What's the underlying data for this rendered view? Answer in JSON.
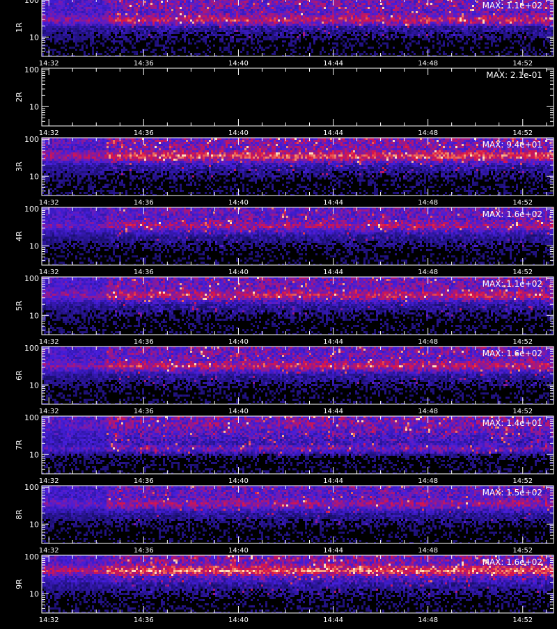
{
  "chart_data": [
    {
      "type": "heatmap",
      "ylabel": "1R",
      "max_label": "MAX: 1.1e+02",
      "max_value": 110,
      "intensity": 0.9,
      "band_rel": 0.35
    },
    {
      "type": "heatmap",
      "ylabel": "2R",
      "max_label": "MAX: 2.1e-01",
      "max_value": 0.21,
      "intensity": 0.0,
      "band_rel": 0.35
    },
    {
      "type": "heatmap",
      "ylabel": "3R",
      "max_label": "MAX: 9.4e+01",
      "max_value": 94,
      "intensity": 1.0,
      "band_rel": 0.3
    },
    {
      "type": "heatmap",
      "ylabel": "4R",
      "max_label": "MAX: 1.6e+02",
      "max_value": 160,
      "intensity": 0.75,
      "band_rel": 0.3
    },
    {
      "type": "heatmap",
      "ylabel": "5R",
      "max_label": "MAX: 1.1e+02",
      "max_value": 110,
      "intensity": 0.85,
      "band_rel": 0.3
    },
    {
      "type": "heatmap",
      "ylabel": "6R",
      "max_label": "MAX: 1.6e+02",
      "max_value": 160,
      "intensity": 0.85,
      "band_rel": 0.32
    },
    {
      "type": "heatmap",
      "ylabel": "7R",
      "max_label": "MAX: 1.4e+01",
      "max_value": 14,
      "intensity": 0.95,
      "band_rel": 0.55
    },
    {
      "type": "heatmap",
      "ylabel": "8R",
      "max_label": "MAX: 1.5e+02",
      "max_value": 150,
      "intensity": 0.7,
      "band_rel": 0.3
    },
    {
      "type": "heatmap",
      "ylabel": "9R",
      "max_label": "MAX: 1.6e+02",
      "max_value": 160,
      "intensity": 1.0,
      "band_rel": 0.25
    }
  ],
  "shared_axes": {
    "x_ticks": [
      "14:32",
      "14:36",
      "14:40",
      "14:44",
      "14:48",
      "14:52"
    ],
    "x_tick_minutes": [
      32,
      36,
      40,
      44,
      48,
      52
    ],
    "x_range_minutes": [
      31.7,
      53.3
    ],
    "y_ticks": [
      "100",
      "10"
    ],
    "y_tick_values": [
      100,
      10
    ],
    "y_range": [
      3,
      110
    ],
    "y_scale": "log"
  },
  "colors": {
    "background": "#000000",
    "axes": "#ffffff",
    "low": "#2020c8",
    "mid": "#c01830",
    "high": "#ffa020"
  }
}
